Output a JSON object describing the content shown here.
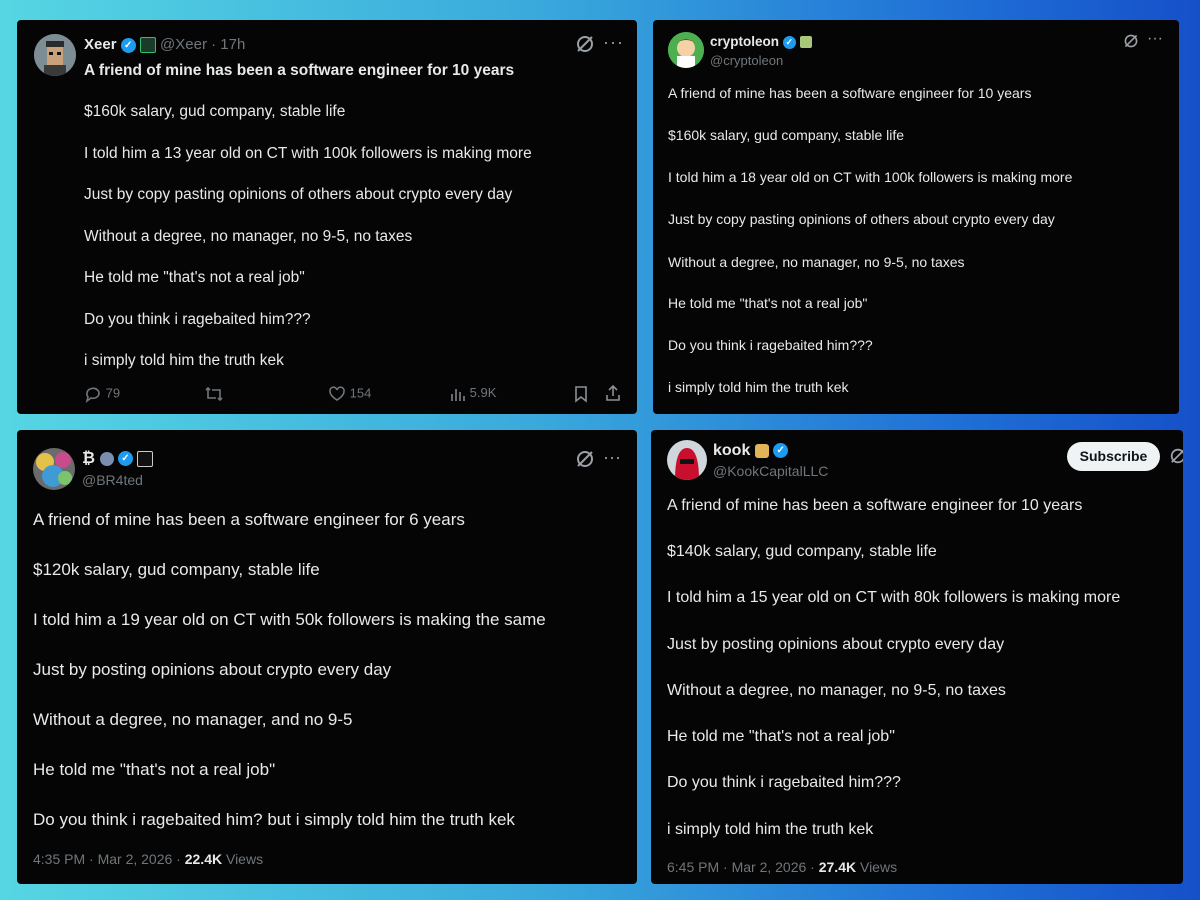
{
  "tweet1": {
    "display_name": "Xeer",
    "handle_time": "@Xeer · 17h",
    "lines": [
      "A friend of mine has been a software engineer for 10 years",
      "$160k salary, gud company, stable life",
      "I told him a 13 year old on CT with 100k followers is making more",
      "Just by copy pasting opinions of others about crypto every day",
      "Without a degree, no manager, no 9-5, no taxes",
      "He told me \"that's not a real job\"",
      "Do you think i ragebaited him???",
      "i simply told him the truth kek"
    ],
    "stats": {
      "replies": "79",
      "likes": "154",
      "views": "5.9K"
    }
  },
  "tweet2": {
    "display_name": "cryptoleon",
    "handle": "@cryptoleon",
    "lines": [
      "A friend of mine has been a software engineer for 10 years",
      "$160k salary, gud company, stable life",
      "I told him a 18 year old on CT with 100k followers is making more",
      "Just by copy pasting opinions of others about crypto every day",
      "Without a degree, no manager, no 9-5, no taxes",
      "He told me \"that's not a real job\"",
      "Do you think i ragebaited him???",
      "i simply told him the truth kek"
    ]
  },
  "tweet3": {
    "display_name": "₿",
    "handle": "@BR4ted",
    "lines": [
      "A friend of mine has been a software engineer for 6 years",
      "$120k salary, gud company, stable life",
      "I told him a 19 year old on CT with 50k followers is making the same",
      "Just by posting opinions about crypto every day",
      "Without a degree, no manager, and no 9-5",
      "He told me \"that's not a real job\"",
      "Do you think i ragebaited him? but i simply told him the truth kek"
    ],
    "timestamp": "4:35 PM · Mar 2, 2026 ·",
    "views_count": "22.4K",
    "views_label": "Views"
  },
  "tweet4": {
    "display_name": "kook",
    "handle": "@KookCapitalLLC",
    "subscribe_label": "Subscribe",
    "lines": [
      "A friend of mine has been a software engineer for 10 years",
      "$140k salary, gud company, stable life",
      "I told him a 15 year old on CT with 80k followers is making more",
      "Just by posting opinions about crypto every day",
      "Without a degree, no manager, no 9-5, no taxes",
      "He told me \"that's not a real job\"",
      "Do you think i ragebaited him???",
      "i simply told him the truth kek"
    ],
    "timestamp": "6:45 PM · Mar 2, 2026 ·",
    "views_count": "27.4K",
    "views_label": "Views"
  },
  "icons": {
    "grok": "grok-icon",
    "more": "more-icon",
    "reply": "reply-icon",
    "retweet": "retweet-icon",
    "like": "like-icon",
    "views": "views-icon",
    "bookmark": "bookmark-icon",
    "share": "share-icon"
  },
  "colors": {
    "card_bg": "#050505",
    "text": "#e7e9ea",
    "muted": "#71767b",
    "verified": "#1d9bf0"
  }
}
